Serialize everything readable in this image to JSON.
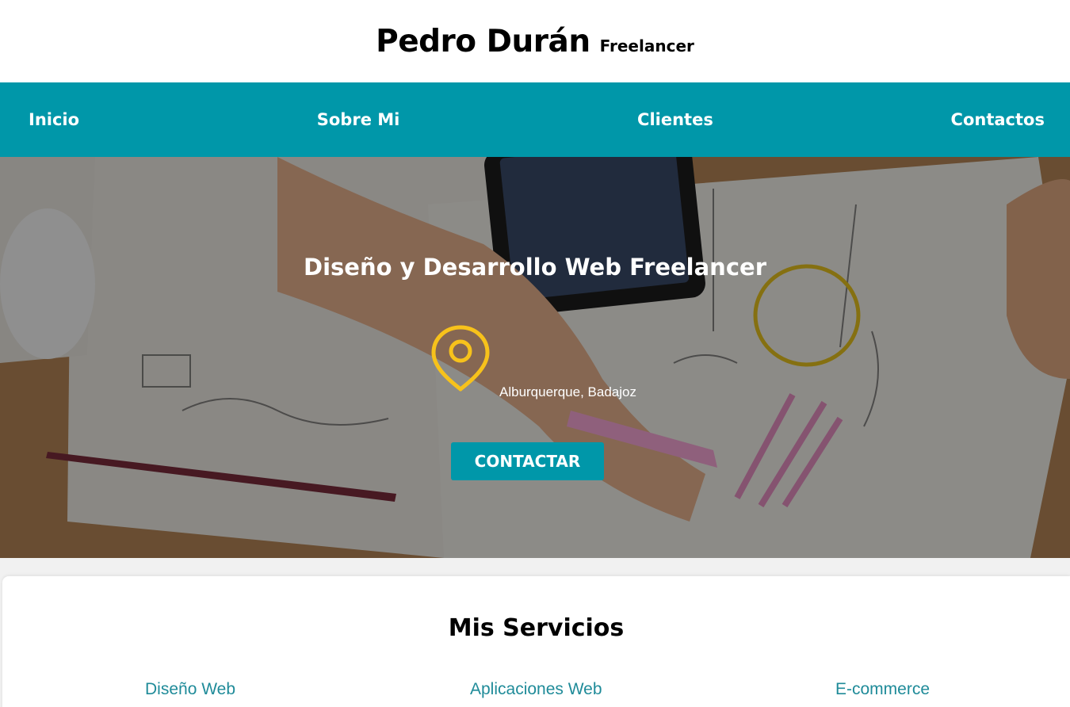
{
  "header": {
    "name": "Pedro Durán",
    "tagline": "Freelancer"
  },
  "nav": {
    "items": [
      "Inicio",
      "Sobre Mi",
      "Clientes",
      "Contactos"
    ]
  },
  "hero": {
    "title": "Diseño y Desarrollo Web Freelancer",
    "location_icon": "location-pin-icon",
    "location": "Alburquerque, Badajoz",
    "button_label": "CONTACTAR"
  },
  "services": {
    "title": "Mis Servicios",
    "items": [
      "Diseño Web",
      "Aplicaciones Web",
      "E-commerce"
    ]
  },
  "colors": {
    "brand": "#0097a9",
    "accent_icon": "#f7c21b",
    "service_link": "#1f8b99"
  }
}
